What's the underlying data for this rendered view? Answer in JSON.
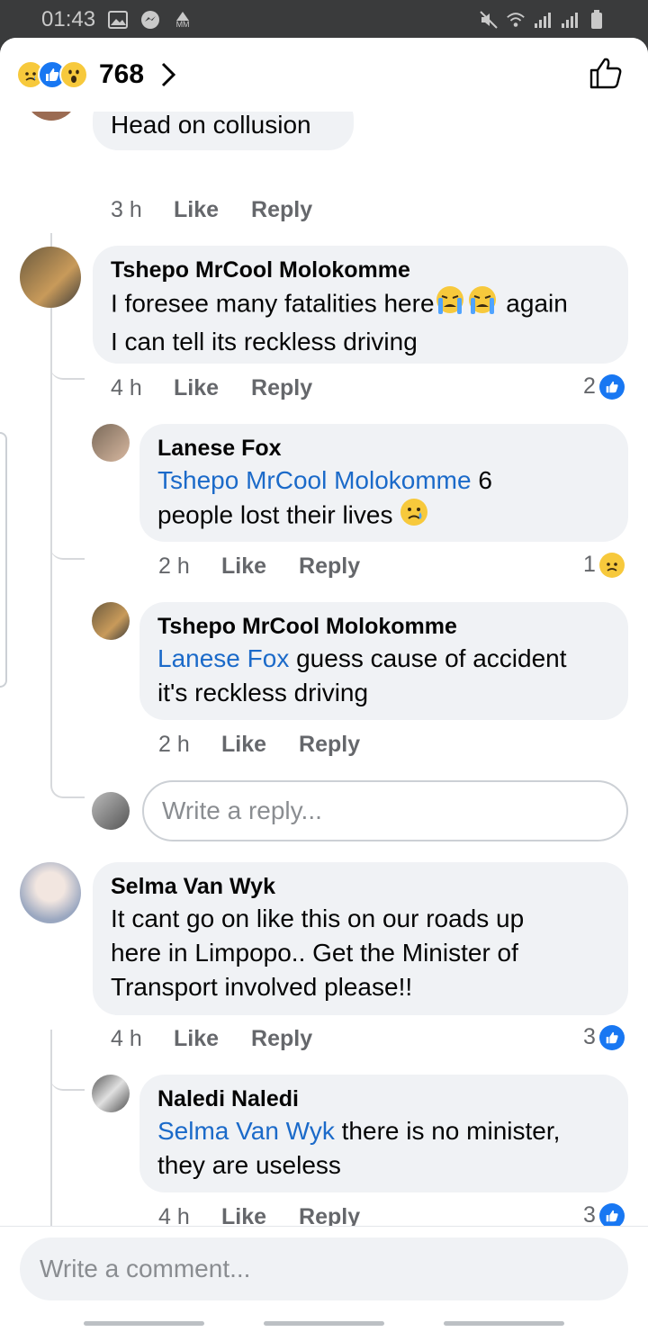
{
  "status_bar": {
    "time": "01:43",
    "network_label": "MM"
  },
  "header": {
    "reaction_count": "768",
    "reactions": [
      "sad-icon",
      "like-icon",
      "wow-icon"
    ]
  },
  "comments": [
    {
      "text": "Head on collusion",
      "time": "3 h",
      "like": "Like",
      "reply": "Reply"
    },
    {
      "author": "Tshepo MrCool Molokomme",
      "text1": "I foresee many fatalities here",
      "text1_after": " again",
      "text2": "I can tell its reckless driving",
      "time": "4 h",
      "like": "Like",
      "reply": "Reply",
      "reactions": "2"
    },
    {
      "author": "Lanese Fox",
      "mention": "Tshepo MrCool Molokomme",
      "text_after_mention": " 6",
      "text2": "people lost their lives ",
      "time": "2 h",
      "like": "Like",
      "reply": "Reply",
      "reactions": "1"
    },
    {
      "author": "Tshepo MrCool Molokomme",
      "mention": "Lanese Fox",
      "text_after_mention": " guess cause of accident",
      "text2": "it's reckless driving",
      "time": "2 h",
      "like": "Like",
      "reply": "Reply"
    },
    {
      "author": "Selma Van Wyk",
      "line1": "It cant go on like this on our roads up",
      "line2": "here in  Limpopo.. Get the Minister of",
      "line3": "Transport involved please!!",
      "time": "4 h",
      "like": "Like",
      "reply": "Reply",
      "reactions": "3"
    },
    {
      "author": "Naledi Naledi",
      "mention": "Selma Van Wyk",
      "text_after_mention": " there is no minister,",
      "text2": "they are useless",
      "time": "4 h",
      "like": "Like",
      "reply": "Reply",
      "reactions": "3"
    }
  ],
  "reply_input": {
    "placeholder": "Write a reply..."
  },
  "comment_input": {
    "placeholder": "Write a comment..."
  }
}
